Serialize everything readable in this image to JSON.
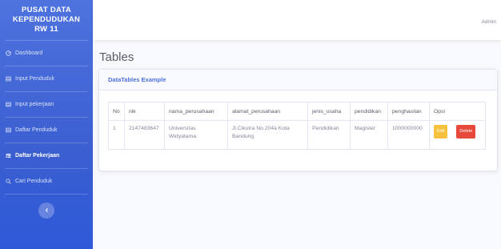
{
  "sidebar": {
    "brand": {
      "line1": "PUSAT DATA",
      "line2": "KEPENDUDUKAN",
      "line3": "RW 11"
    },
    "items": [
      {
        "label": "Dashboard",
        "icon": "dashboard-icon",
        "active": false
      },
      {
        "label": "Input Penduduk",
        "icon": "table-icon",
        "active": false
      },
      {
        "label": "Input pekerjaan",
        "icon": "table-icon",
        "active": false
      },
      {
        "label": "Daftar Penduduk",
        "icon": "table-icon",
        "active": false
      },
      {
        "label": "Daftar Pekerjaan",
        "icon": "table-icon",
        "active": true
      },
      {
        "label": "Cari Penduduk",
        "icon": "search-icon",
        "active": false
      }
    ],
    "toggle_icon": "chevron-left-icon"
  },
  "topbar": {
    "user": "Admin"
  },
  "page": {
    "title": "Tables"
  },
  "card": {
    "header": "DataTables Example"
  },
  "table": {
    "columns": [
      "No",
      "nik",
      "nama_perusahaan",
      "alamat_perusahaan",
      "jenis_usaha",
      "pendidikan",
      "penghasilan",
      "Opsi"
    ],
    "rows": [
      {
        "no": "1",
        "nik": "2147483647",
        "nama_perusahaan": "Universitas Widyatama",
        "alamat_perusahaan": "Jl.Cikutra No.204a Kota Bandung",
        "jenis_usaha": "Pendidikan",
        "pendidikan": "Magister",
        "penghasilan": "1000000000",
        "edit_label": "Edit",
        "delete_label": "Delete"
      }
    ]
  },
  "colors": {
    "primary": "#4e73df",
    "warning": "#f6c23e",
    "danger": "#e74a3b"
  }
}
